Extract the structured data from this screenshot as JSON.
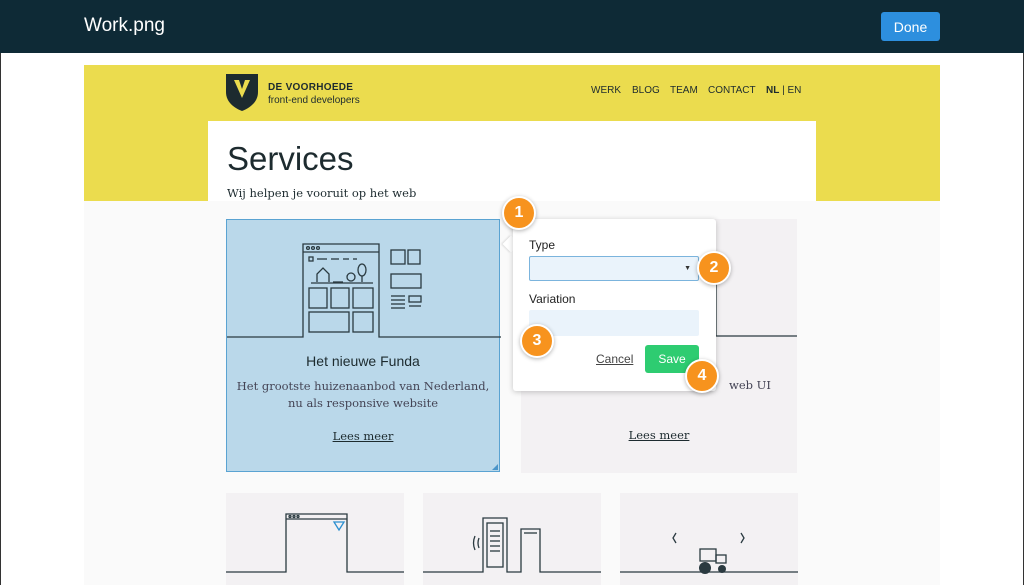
{
  "app": {
    "title": "Work.png",
    "done_label": "Done"
  },
  "site": {
    "brand_name": "DE VOORHOEDE",
    "brand_tagline": "front-end developers",
    "nav": [
      "WERK",
      "BLOG",
      "TEAM",
      "CONTACT"
    ],
    "lang_active": "NL",
    "lang_sep": " | ",
    "lang_other": "EN",
    "page_title": "Services",
    "page_subtitle": "Wij helpen je vooruit op het web"
  },
  "cards": [
    {
      "title": "Het nieuwe Funda",
      "description": "Het grootste huizenaanbod van Nederland, nu als responsive website",
      "link": "Lees meer"
    },
    {
      "description_partial": "web UI",
      "link": "Lees meer"
    }
  ],
  "popover": {
    "type_label": "Type",
    "type_value": "",
    "variation_label": "Variation",
    "variation_value": "",
    "cancel_label": "Cancel",
    "save_label": "Save"
  },
  "markers": [
    "1",
    "2",
    "3",
    "4"
  ],
  "colors": {
    "appbar": "#0e2a36",
    "done": "#2d8fde",
    "header_yellow": "#ebdc4e",
    "selected_card": "#bad8ea",
    "save": "#2ecc71",
    "marker": "#f7931e"
  }
}
